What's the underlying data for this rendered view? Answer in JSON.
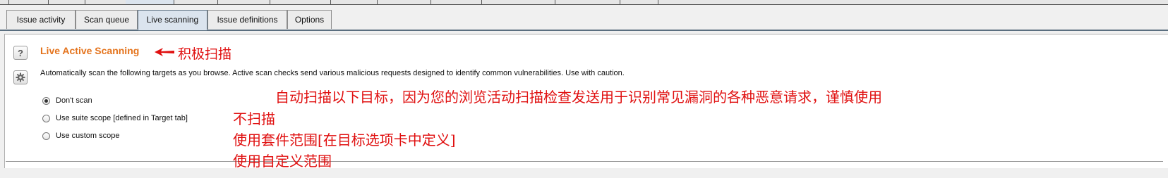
{
  "tabs": [
    {
      "label": "Issue activity",
      "active": false
    },
    {
      "label": "Scan queue",
      "active": false
    },
    {
      "label": "Live scanning",
      "active": true
    },
    {
      "label": "Issue definitions",
      "active": false
    },
    {
      "label": "Options",
      "active": false
    }
  ],
  "section": {
    "title": "Live Active Scanning",
    "title_annotation": "积极扫描",
    "description": "Automatically scan the following targets as you browse. Active scan checks send various malicious requests designed to identify common vulnerabilities. Use with caution.",
    "description_annotation": "自动扫描以下目标，因为您的浏览活动扫描检查发送用于识别常见漏洞的各种恶意请求，谨慎使用"
  },
  "options": [
    {
      "label": "Don't scan",
      "checked": true,
      "annotation": "不扫描"
    },
    {
      "label": "Use suite scope [defined in Target tab]",
      "checked": false,
      "annotation": "使用套件范围[在目标选项卡中定义]"
    },
    {
      "label": "Use custom scope",
      "checked": false,
      "annotation": "使用自定义范围"
    }
  ],
  "icons": {
    "help": "help-icon",
    "settings": "gear-icon"
  },
  "colors": {
    "title": "#e4731c",
    "annotation": "#e01010",
    "active_tab": "#dbe4ee"
  }
}
